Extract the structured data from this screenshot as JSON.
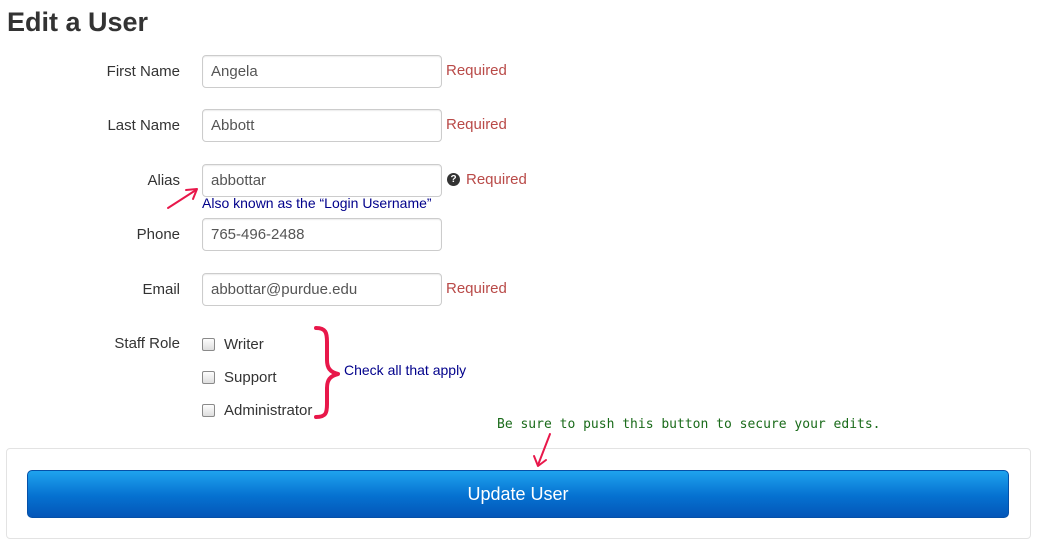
{
  "page": {
    "title": "Edit a User"
  },
  "form": {
    "first_name": {
      "label": "First Name",
      "value": "Angela",
      "required": "Required"
    },
    "last_name": {
      "label": "Last Name",
      "value": "Abbott",
      "required": "Required"
    },
    "alias": {
      "label": "Alias",
      "value": "abbottar",
      "help_icon": "question-circle-icon",
      "help_glyph": "?",
      "required": "Required"
    },
    "phone": {
      "label": "Phone",
      "value": "765-496-2488"
    },
    "email": {
      "label": "Email",
      "value": "abbottar@purdue.edu",
      "required": "Required"
    },
    "staff_role": {
      "label": "Staff Role",
      "options": [
        {
          "label": "Writer",
          "checked": false
        },
        {
          "label": "Support",
          "checked": false
        },
        {
          "label": "Administrator",
          "checked": false
        }
      ]
    },
    "update_button": "Update User"
  },
  "annotations": {
    "alias_note": "Also known as the “Login Username”",
    "role_note": "Check all that apply",
    "button_note": "Be sure to push this button to secure your edits.",
    "arrow_color": "#e8174a"
  },
  "colors": {
    "required": "#b94a48",
    "note_blue": "#00008b",
    "note_green": "#1a6b1a",
    "button": "#0571d0"
  }
}
